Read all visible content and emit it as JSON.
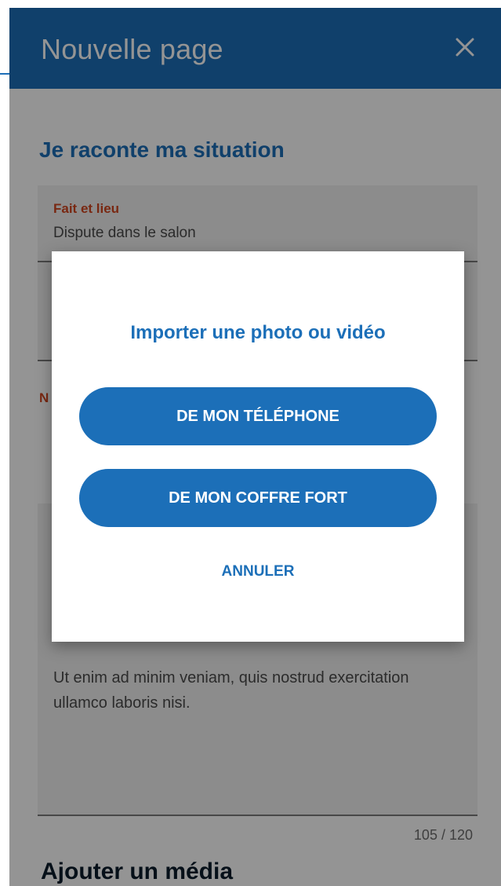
{
  "header": {
    "title": "Nouvelle page",
    "close_icon": "close-icon",
    "color": "#1c6fb8"
  },
  "section": {
    "title": "Je raconte ma situation",
    "fields": {
      "fait_et_lieu": {
        "label": "Fait et lieu",
        "value": "Dispute dans le salon"
      },
      "third_label_initial": "N",
      "description_text": "Ut enim ad minim veniam, quis nostrud exercitation ullamco laboris nisi.",
      "counter": "105 / 120"
    },
    "second_title": "Ajouter un média"
  },
  "dialog": {
    "title": "Importer une photo ou vidéo",
    "button_phone": "DE MON TÉLÉPHONE",
    "button_vault": "DE MON COFFRE FORT",
    "cancel": "ANNULER"
  },
  "colors": {
    "primary": "#1c6fb8",
    "label_accent": "#d1461f"
  }
}
